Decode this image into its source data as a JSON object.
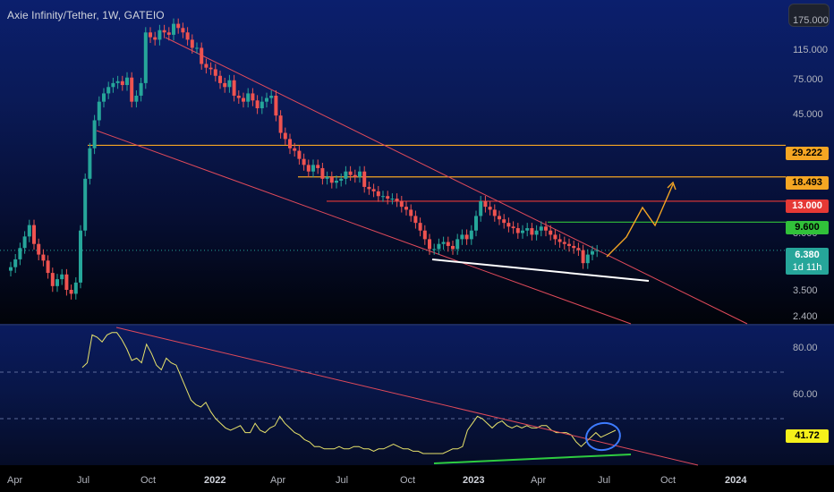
{
  "header": {
    "title": "Axie Infinity/Tether, 1W, GATEIO"
  },
  "chart_data": [
    {
      "type": "candlestick",
      "title": "Axie Infinity/Tether, 1W, GATEIO",
      "y_scale": "log",
      "ylim": [
        2.2,
        240
      ],
      "y_tick_labels": [
        "175.000",
        "115.000",
        "75.000",
        "45.000",
        "8.000",
        "3.500",
        "2.400"
      ],
      "y_ticks": [
        175,
        115,
        75,
        45,
        8,
        3.5,
        2.4
      ],
      "x_tick_labels": [
        "Apr",
        "Jul",
        "Oct",
        "2022",
        "Apr",
        "Jul",
        "Oct",
        "2023",
        "Apr",
        "Jul",
        "Oct",
        "2024"
      ],
      "bold_x_ticks": [
        "2022",
        "2023",
        "2024"
      ],
      "candles_weekly_close_approx": [
        5.0,
        5.6,
        6.6,
        7.8,
        9.2,
        7.0,
        6.0,
        5.5,
        4.6,
        3.8,
        4.2,
        4.5,
        3.6,
        3.4,
        4.0,
        8.5,
        18,
        28,
        42,
        55,
        62,
        68,
        72,
        74,
        70,
        78,
        55,
        60,
        72,
        150,
        140,
        135,
        155,
        150,
        145,
        170,
        160,
        150,
        135,
        120,
        120,
        95,
        90,
        88,
        80,
        72,
        68,
        75,
        60,
        58,
        55,
        62,
        56,
        50,
        55,
        58,
        60,
        45,
        35,
        32,
        28,
        27,
        24,
        22,
        20,
        22,
        21,
        18,
        18.5,
        17,
        17.5,
        18,
        20,
        19,
        18.5,
        20,
        16,
        15.5,
        15,
        14,
        14,
        13.5,
        13.5,
        13,
        12,
        11.5,
        10.5,
        9.5,
        8.5,
        7.5,
        6.5,
        6.5,
        7.0,
        7.2,
        6.8,
        6.5,
        7.5,
        8.0,
        7.5,
        8.5,
        10.5,
        13,
        12,
        11.5,
        10.5,
        10.0,
        9.5,
        9.0,
        8.8,
        8.2,
        8.5,
        8.8,
        8.0,
        8.5,
        9.0,
        8.5,
        8.0,
        7.5,
        7.2,
        7.0,
        6.8,
        6.6,
        6.4,
        5.3,
        6.0,
        6.3,
        6.38
      ],
      "horizontal_levels": [
        {
          "value": 29.222,
          "label": "29.222",
          "color": "#f5a623"
        },
        {
          "value": 18.493,
          "label": "18.493",
          "color": "#f5a623"
        },
        {
          "value": 13.0,
          "label": "13.000",
          "color": "#e53935"
        },
        {
          "value": 9.6,
          "label": "9.600",
          "color": "#31c13a"
        }
      ],
      "last_price": {
        "value": 6.38,
        "label": "6.380",
        "countdown": "1d 11h",
        "color": "#26a69a"
      },
      "annotations": [
        {
          "kind": "descending channel",
          "color": "#e04a5a"
        },
        {
          "kind": "support line",
          "color": "#ffffff"
        },
        {
          "kind": "projected zig-zag path",
          "color": "#f5a623"
        }
      ]
    },
    {
      "type": "line",
      "title": "",
      "ylim": [
        30,
        90
      ],
      "y_tick_labels": [
        "80.00",
        "60.00"
      ],
      "y_ticks": [
        80,
        60
      ],
      "dashed_levels": [
        70,
        50
      ],
      "series": [
        {
          "name": "",
          "values": [
            72,
            74,
            86,
            85,
            83,
            86,
            87,
            87,
            84,
            80,
            75,
            76,
            74,
            82,
            78,
            73,
            71,
            76,
            74,
            73,
            68,
            63,
            58,
            56,
            55,
            57,
            53,
            50,
            48,
            46,
            45,
            46,
            47,
            44,
            44,
            48,
            45,
            44,
            46,
            47,
            51,
            48,
            46,
            44,
            43,
            41,
            40,
            38,
            38,
            37,
            37,
            37,
            38,
            37,
            37,
            38,
            38,
            37,
            37,
            36,
            37,
            37,
            38,
            39,
            38,
            37,
            37,
            36,
            36,
            35,
            35,
            35,
            35,
            35,
            36,
            37,
            37,
            38,
            45,
            48,
            51,
            50,
            48,
            46,
            48,
            49,
            47,
            46,
            47,
            46,
            47,
            46,
            46,
            47,
            47,
            45,
            44,
            44,
            44,
            43,
            40,
            38,
            40,
            42,
            44,
            42,
            43,
            44,
            45
          ],
          "color": "#e8e36b"
        }
      ],
      "last_value": {
        "value": 41.72,
        "label": "41.72",
        "color": "#f5f01a"
      },
      "annotations": [
        {
          "kind": "descending trendline",
          "color": "#e04a5a"
        },
        {
          "kind": "support line",
          "color": "#2ecc40"
        },
        {
          "kind": "circle highlight",
          "color": "#3d7bff"
        }
      ]
    }
  ]
}
